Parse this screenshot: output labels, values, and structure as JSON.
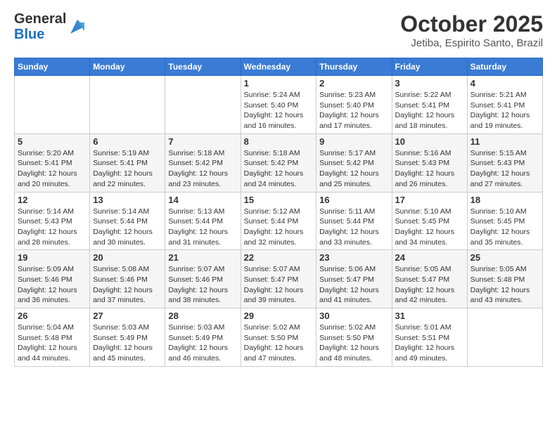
{
  "header": {
    "logo_general": "General",
    "logo_blue": "Blue",
    "month_title": "October 2025",
    "location": "Jetiba, Espirito Santo, Brazil"
  },
  "calendar": {
    "days_of_week": [
      "Sunday",
      "Monday",
      "Tuesday",
      "Wednesday",
      "Thursday",
      "Friday",
      "Saturday"
    ],
    "weeks": [
      [
        {
          "day": "",
          "info": ""
        },
        {
          "day": "",
          "info": ""
        },
        {
          "day": "",
          "info": ""
        },
        {
          "day": "1",
          "info": "Sunrise: 5:24 AM\nSunset: 5:40 PM\nDaylight: 12 hours\nand 16 minutes."
        },
        {
          "day": "2",
          "info": "Sunrise: 5:23 AM\nSunset: 5:40 PM\nDaylight: 12 hours\nand 17 minutes."
        },
        {
          "day": "3",
          "info": "Sunrise: 5:22 AM\nSunset: 5:41 PM\nDaylight: 12 hours\nand 18 minutes."
        },
        {
          "day": "4",
          "info": "Sunrise: 5:21 AM\nSunset: 5:41 PM\nDaylight: 12 hours\nand 19 minutes."
        }
      ],
      [
        {
          "day": "5",
          "info": "Sunrise: 5:20 AM\nSunset: 5:41 PM\nDaylight: 12 hours\nand 20 minutes."
        },
        {
          "day": "6",
          "info": "Sunrise: 5:19 AM\nSunset: 5:41 PM\nDaylight: 12 hours\nand 22 minutes."
        },
        {
          "day": "7",
          "info": "Sunrise: 5:18 AM\nSunset: 5:42 PM\nDaylight: 12 hours\nand 23 minutes."
        },
        {
          "day": "8",
          "info": "Sunrise: 5:18 AM\nSunset: 5:42 PM\nDaylight: 12 hours\nand 24 minutes."
        },
        {
          "day": "9",
          "info": "Sunrise: 5:17 AM\nSunset: 5:42 PM\nDaylight: 12 hours\nand 25 minutes."
        },
        {
          "day": "10",
          "info": "Sunrise: 5:16 AM\nSunset: 5:43 PM\nDaylight: 12 hours\nand 26 minutes."
        },
        {
          "day": "11",
          "info": "Sunrise: 5:15 AM\nSunset: 5:43 PM\nDaylight: 12 hours\nand 27 minutes."
        }
      ],
      [
        {
          "day": "12",
          "info": "Sunrise: 5:14 AM\nSunset: 5:43 PM\nDaylight: 12 hours\nand 28 minutes."
        },
        {
          "day": "13",
          "info": "Sunrise: 5:14 AM\nSunset: 5:44 PM\nDaylight: 12 hours\nand 30 minutes."
        },
        {
          "day": "14",
          "info": "Sunrise: 5:13 AM\nSunset: 5:44 PM\nDaylight: 12 hours\nand 31 minutes."
        },
        {
          "day": "15",
          "info": "Sunrise: 5:12 AM\nSunset: 5:44 PM\nDaylight: 12 hours\nand 32 minutes."
        },
        {
          "day": "16",
          "info": "Sunrise: 5:11 AM\nSunset: 5:44 PM\nDaylight: 12 hours\nand 33 minutes."
        },
        {
          "day": "17",
          "info": "Sunrise: 5:10 AM\nSunset: 5:45 PM\nDaylight: 12 hours\nand 34 minutes."
        },
        {
          "day": "18",
          "info": "Sunrise: 5:10 AM\nSunset: 5:45 PM\nDaylight: 12 hours\nand 35 minutes."
        }
      ],
      [
        {
          "day": "19",
          "info": "Sunrise: 5:09 AM\nSunset: 5:46 PM\nDaylight: 12 hours\nand 36 minutes."
        },
        {
          "day": "20",
          "info": "Sunrise: 5:08 AM\nSunset: 5:46 PM\nDaylight: 12 hours\nand 37 minutes."
        },
        {
          "day": "21",
          "info": "Sunrise: 5:07 AM\nSunset: 5:46 PM\nDaylight: 12 hours\nand 38 minutes."
        },
        {
          "day": "22",
          "info": "Sunrise: 5:07 AM\nSunset: 5:47 PM\nDaylight: 12 hours\nand 39 minutes."
        },
        {
          "day": "23",
          "info": "Sunrise: 5:06 AM\nSunset: 5:47 PM\nDaylight: 12 hours\nand 41 minutes."
        },
        {
          "day": "24",
          "info": "Sunrise: 5:05 AM\nSunset: 5:47 PM\nDaylight: 12 hours\nand 42 minutes."
        },
        {
          "day": "25",
          "info": "Sunrise: 5:05 AM\nSunset: 5:48 PM\nDaylight: 12 hours\nand 43 minutes."
        }
      ],
      [
        {
          "day": "26",
          "info": "Sunrise: 5:04 AM\nSunset: 5:48 PM\nDaylight: 12 hours\nand 44 minutes."
        },
        {
          "day": "27",
          "info": "Sunrise: 5:03 AM\nSunset: 5:49 PM\nDaylight: 12 hours\nand 45 minutes."
        },
        {
          "day": "28",
          "info": "Sunrise: 5:03 AM\nSunset: 5:49 PM\nDaylight: 12 hours\nand 46 minutes."
        },
        {
          "day": "29",
          "info": "Sunrise: 5:02 AM\nSunset: 5:50 PM\nDaylight: 12 hours\nand 47 minutes."
        },
        {
          "day": "30",
          "info": "Sunrise: 5:02 AM\nSunset: 5:50 PM\nDaylight: 12 hours\nand 48 minutes."
        },
        {
          "day": "31",
          "info": "Sunrise: 5:01 AM\nSunset: 5:51 PM\nDaylight: 12 hours\nand 49 minutes."
        },
        {
          "day": "",
          "info": ""
        }
      ]
    ]
  }
}
